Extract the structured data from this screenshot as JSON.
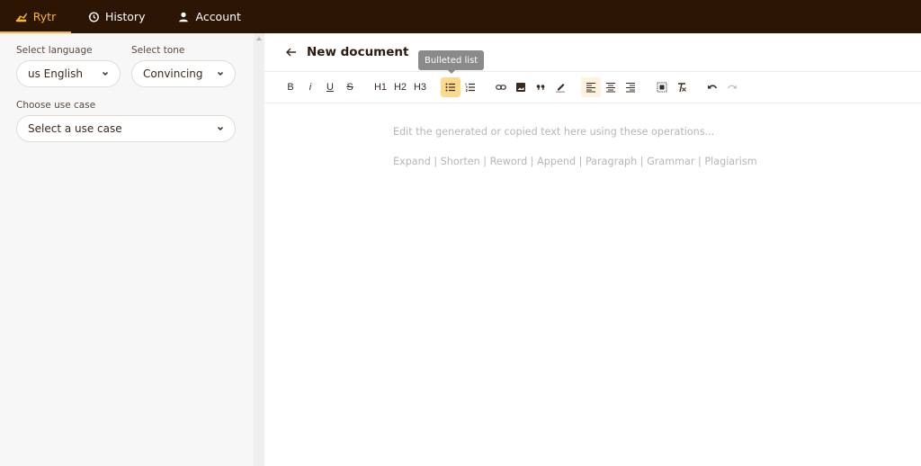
{
  "nav": {
    "items": [
      {
        "label": "Rytr",
        "icon": "rytr-logo-icon",
        "active": true
      },
      {
        "label": "History",
        "icon": "history-icon",
        "active": false
      },
      {
        "label": "Account",
        "icon": "user-icon",
        "active": false
      }
    ]
  },
  "sidebar": {
    "language": {
      "label": "Select language",
      "value": "us English"
    },
    "tone": {
      "label": "Select tone",
      "value": "Convincing"
    },
    "use_case": {
      "label": "Choose use case",
      "value": "Select a use case"
    }
  },
  "document": {
    "back_icon": "arrow-left-icon",
    "title": "New document",
    "tooltip": "Bulleted list",
    "toolbar": {
      "bold": "B",
      "italic": "i",
      "underline": "U",
      "strike": "S",
      "h1": "H1",
      "h2": "H2",
      "h3": "H3",
      "active_tool": "bulleted-list"
    },
    "placeholder_line1": "Edit the generated or copied text here using these operations...",
    "placeholder_line2": "Expand | Shorten | Reword | Append | Paragraph | Grammar | Plagiarism"
  },
  "colors": {
    "topbar": "#2c1503",
    "accent": "#f7b733",
    "active_tool": "#fcd98b"
  }
}
